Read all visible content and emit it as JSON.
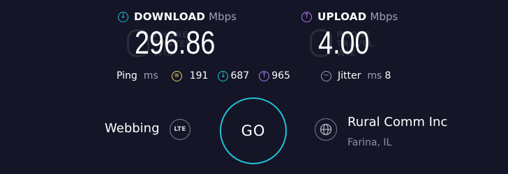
{
  "download": {
    "label": "DOWNLOAD",
    "unit": "Mbps",
    "value": "296.86",
    "icon": "download-arrow-icon",
    "color": "#20c2d8"
  },
  "upload": {
    "label": "UPLOAD",
    "unit": "Mbps",
    "value": "4.00",
    "icon": "upload-arrow-icon",
    "color": "#b07cf0"
  },
  "watermark": {
    "line1": "PHONE",
    "line2": "TRAVEL",
    "line3": "WIZ"
  },
  "ping": {
    "label": "Ping",
    "unit": "ms",
    "idle": "191",
    "download": "687",
    "upload": "965",
    "idle_color": "#e8d36a"
  },
  "jitter": {
    "label": "Jitter",
    "unit": "ms",
    "value": "8"
  },
  "provider": {
    "name": "Webbing",
    "connection": "LTE"
  },
  "go_label": "GO",
  "server": {
    "name": "Rural Comm Inc",
    "location": "Farina, IL",
    "icon": "globe-icon"
  }
}
